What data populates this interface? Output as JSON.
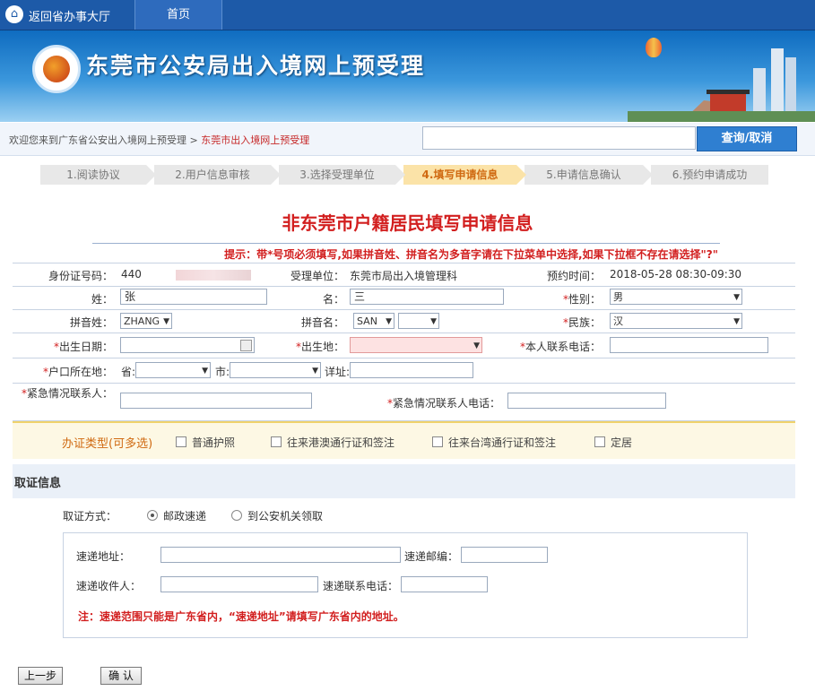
{
  "topnav": {
    "back_label": "返回省办事大厅",
    "home_label": "首页"
  },
  "banner": {
    "title": "东莞市公安局出入境网上预受理"
  },
  "subheader": {
    "breadcrumb_root": "欢迎您来到广东省公安出入境网上预受理",
    "breadcrumb_sep": ">",
    "breadcrumb_current": "东莞市出入境网上预受理",
    "search_value": "",
    "query_button": "查询/取消"
  },
  "steps": [
    {
      "label": "1.阅读协议",
      "active": false
    },
    {
      "label": "2.用户信息审核",
      "active": false
    },
    {
      "label": "3.选择受理单位",
      "active": false
    },
    {
      "label": "4.填写申请信息",
      "active": true
    },
    {
      "label": "5.申请信息确认",
      "active": false
    },
    {
      "label": "6.预约申请成功",
      "active": false
    }
  ],
  "form": {
    "title": "非东莞市户籍居民填写申请信息",
    "hint": "提示：带*号项必须填写,如果拼音姓、拼音名为多音字请在下拉菜单中选择,如果下拉框不存在请选择\"?\"",
    "id_label": "身份证号码：",
    "id_value": "440",
    "unit_label": "受理单位：",
    "unit_value": "东莞市局出入境管理科",
    "time_label": "预约时间：",
    "time_value": "2018-05-28  08:30-09:30",
    "surname_label": "姓：",
    "surname_value": "张",
    "name_label": "名：",
    "name_value": "三",
    "gender_label": "性别：",
    "gender_value": "男",
    "pinyin_surname_label": "拼音姓：",
    "pinyin_surname_value": "ZHANG",
    "pinyin_name_label": "拼音名：",
    "pinyin_name_value": "SAN",
    "pinyin_name_value2": "",
    "ethnicity_label": "民族：",
    "ethnicity_value": "汉",
    "birthdate_label": "出生日期：",
    "birthdate_value": "",
    "birthplace_label": "出生地：",
    "birthplace_value": "",
    "phone_label": "本人联系电话：",
    "phone_value": "",
    "hukou_label": "户口所在地：",
    "province_label": "省:",
    "city_label": "市:",
    "detail_label": "详址:",
    "emergency_label": "紧急情况联系人：",
    "emergency_value": "",
    "emergency_phone_label": "紧急情况联系人电话：",
    "emergency_phone_value": "",
    "star": "*"
  },
  "doc_types": {
    "label": "办证类型(可多选)",
    "options": [
      "普通护照",
      "往来港澳通行证和签注",
      "往来台湾通行证和签注",
      "定居"
    ]
  },
  "pickup": {
    "section_title": "取证信息",
    "method_label": "取证方式：",
    "option_post": "邮政速递",
    "option_bureau": "到公安机关领取",
    "selected": "邮政速递",
    "address_label": "速递地址：",
    "postcode_label": "速递邮编：",
    "recipient_label": "速递收件人：",
    "contact_label": "速递联系电话：",
    "note": "注：速递范围只能是广东省内，“速递地址”请填写广东省内的地址。"
  },
  "buttons": {
    "prev": "上一步",
    "confirm": "确 认"
  },
  "colors": {
    "nav": "#1d5aa8",
    "accent_red": "#d21f1f",
    "active_step": "#fbe3a8",
    "query_btn": "#2f7fd1"
  }
}
